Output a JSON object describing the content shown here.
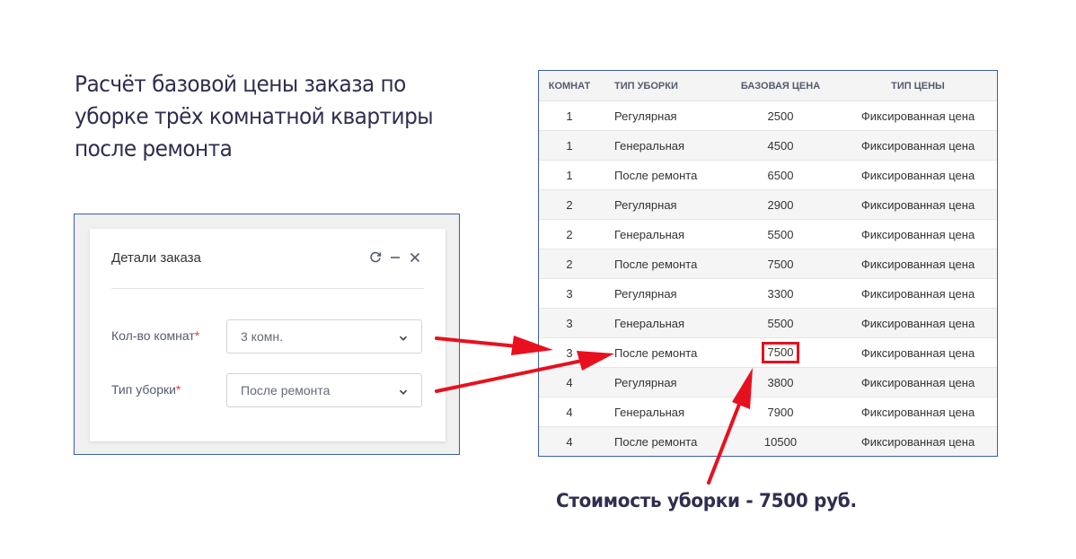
{
  "headline": {
    "lines": [
      "Расчёт базовой цены заказа по",
      "уборке трёх комнатной квартиры",
      "после ремонта"
    ]
  },
  "order_details": {
    "title": "Детали заказа",
    "tools": [
      "refresh-icon",
      "minimize-icon",
      "close-icon"
    ],
    "rooms_field": {
      "label": "Кол-во комнат",
      "required_mark": "*",
      "value": "3 комн."
    },
    "cleaning_type_field": {
      "label": "Тип уборки",
      "required_mark": "*",
      "value": "После ремонта"
    }
  },
  "price_table": {
    "columns": [
      "Комнат",
      "Тип уборки",
      "Базовая цена",
      "Тип цены"
    ],
    "rows": [
      [
        "1",
        "Регулярная",
        "2500",
        "Фиксированная цена"
      ],
      [
        "1",
        "Генеральная",
        "4500",
        "Фиксированная цена"
      ],
      [
        "1",
        "После ремонта",
        "6500",
        "Фиксированная цена"
      ],
      [
        "2",
        "Регулярная",
        "2900",
        "Фиксированная цена"
      ],
      [
        "2",
        "Генеральная",
        "5500",
        "Фиксированная цена"
      ],
      [
        "2",
        "После ремонта",
        "7500",
        "Фиксированная цена"
      ],
      [
        "3",
        "Регулярная",
        "3300",
        "Фиксированная цена"
      ],
      [
        "3",
        "Генеральная",
        "5500",
        "Фиксированная цена"
      ],
      [
        "3",
        "После ремонта",
        "7500",
        "Фиксированная цена"
      ],
      [
        "4",
        "Регулярная",
        "3800",
        "Фиксированная цена"
      ],
      [
        "4",
        "Генеральная",
        "7900",
        "Фиксированная цена"
      ],
      [
        "4",
        "После ремонта",
        "10500",
        "Фиксированная цена"
      ]
    ],
    "highlighted_row": 8
  },
  "caption": "Стоимость уборки - 7500 руб.",
  "colors": {
    "accent_red": "#e8101e",
    "frame_blue": "#3b5ea8",
    "headline_text": "#2f2e4f"
  }
}
